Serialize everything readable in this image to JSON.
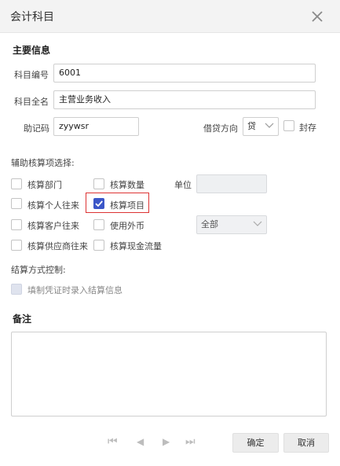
{
  "dialog": {
    "title": "会计科目"
  },
  "icons": {
    "close": "close-icon",
    "checkmark": "check-icon",
    "dropdown": "chevron-down-icon"
  },
  "main_info": {
    "heading": "主要信息",
    "code_label": "科目编号",
    "code_value": "6001",
    "fullname_label": "科目全名",
    "fullname_value": "主营业务收入",
    "mnemonic_label": "助记码",
    "mnemonic_value": "zyywsr",
    "direction_label": "借贷方向",
    "direction_value": "贷",
    "archive_label": "封存",
    "archive_checked": false
  },
  "aux": {
    "heading": "辅助核算项选择:",
    "dept": {
      "label": "核算部门",
      "checked": false
    },
    "quantity": {
      "label": "核算数量",
      "checked": false
    },
    "unit_label": "单位",
    "unit_value": "",
    "personal": {
      "label": "核算个人往来",
      "checked": false
    },
    "project": {
      "label": "核算项目",
      "checked": true
    },
    "customer": {
      "label": "核算客户往来",
      "checked": false
    },
    "foreign": {
      "label": "使用外币",
      "checked": false
    },
    "currency_value": "全部",
    "supplier": {
      "label": "核算供应商往来",
      "checked": false
    },
    "cashflow": {
      "label": "核算现金流量",
      "checked": false
    }
  },
  "settlement": {
    "heading": "结算方式控制:",
    "record": {
      "label": "填制凭证时录入结算信息",
      "checked": false
    }
  },
  "remarks": {
    "heading": "备注",
    "value": ""
  },
  "footer": {
    "pager_first": "⏮",
    "pager_prev": "◀",
    "pager_next": "▶",
    "pager_last": "⏭",
    "ok_label": "确定",
    "cancel_label": "取消"
  },
  "colors": {
    "accent": "#3b56c8",
    "highlight_border": "#dd3333",
    "titlebar_bg": "#f3f3f3"
  }
}
